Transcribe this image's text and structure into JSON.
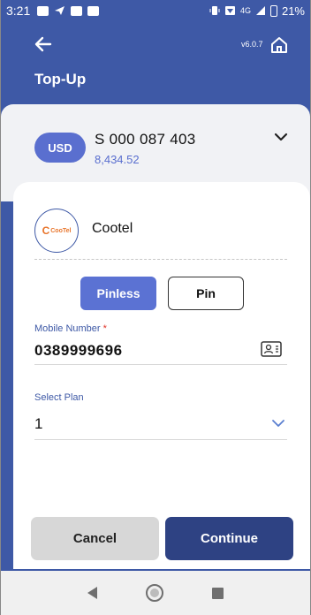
{
  "status_bar": {
    "time": "3:21",
    "network": "4G",
    "battery": "21%"
  },
  "header": {
    "title": "Top-Up",
    "version": "v6.0.7",
    "back_icon": "arrow-left-icon",
    "home_icon": "home-icon"
  },
  "account": {
    "currency": "USD",
    "number": "S 000 087 403",
    "balance": "8,434.52"
  },
  "operator": {
    "name": "Cootel",
    "logo_text": "CooTel"
  },
  "segment": {
    "options": [
      "Pinless",
      "Pin"
    ],
    "selected": "Pinless"
  },
  "mobile": {
    "label": "Mobile Number",
    "required_mark": "*",
    "value": "0389999696"
  },
  "plan": {
    "label": "Select Plan",
    "value": "1"
  },
  "actions": {
    "cancel": "Cancel",
    "continue": "Continue"
  },
  "colors": {
    "primary": "#3e59a6",
    "accent": "#5b72d3",
    "continue_bg": "#2e4283",
    "cancel_bg": "#d7d7d7"
  }
}
